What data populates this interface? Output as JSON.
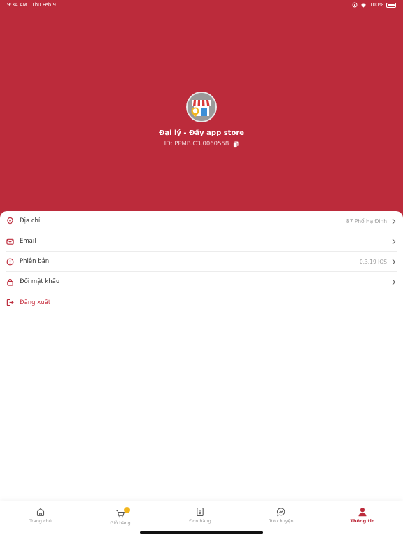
{
  "status_bar": {
    "time": "9:34 AM",
    "date": "Thu Feb 9",
    "battery": "100%"
  },
  "profile": {
    "store_name": "Đại lý - Đẩy app store",
    "store_id": "ID: PPMB.C3.0060558"
  },
  "menu": [
    {
      "icon": "location-pin-icon",
      "label": "Địa chỉ",
      "value": "87 Phố Hạ Đình"
    },
    {
      "icon": "mail-icon",
      "label": "Email",
      "value": ""
    },
    {
      "icon": "info-icon",
      "label": "Phiên bản",
      "value": "0.3.19 IOS"
    },
    {
      "icon": "lock-icon",
      "label": "Đổi mật khẩu",
      "value": ""
    },
    {
      "icon": "logout-icon",
      "label": "Đăng xuất",
      "value": ""
    }
  ],
  "tabs": [
    {
      "icon": "home-icon",
      "label": "Trang chủ"
    },
    {
      "icon": "cart-icon",
      "label": "Giỏ hàng",
      "badge": "1"
    },
    {
      "icon": "orders-icon",
      "label": "Đơn hàng"
    },
    {
      "icon": "chat-icon",
      "label": "Trò chuyện"
    },
    {
      "icon": "user-icon",
      "label": "Thông tin"
    }
  ],
  "colors": {
    "primary": "#bc2b3b",
    "badge": "#f2b61d"
  }
}
